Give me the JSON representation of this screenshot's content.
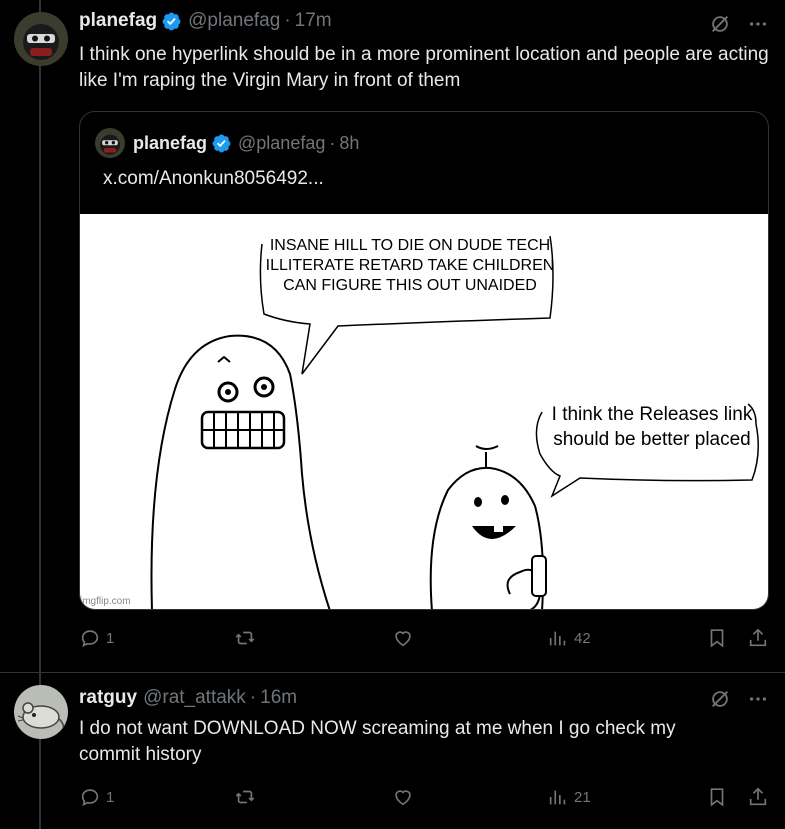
{
  "tweets": [
    {
      "name": "planefag",
      "handle": "@planefag",
      "separator": "·",
      "time": "17m",
      "text": "I think one hyperlink should be in a more prominent location and people are acting like I'm raping the Virgin Mary in front of them",
      "quote": {
        "name": "planefag",
        "handle": "@planefag",
        "separator": "·",
        "time": "8h",
        "link": "x.com/Anonkun8056492...",
        "image": {
          "bubble_left": "INSANE HILL TO DIE ON DUDE TECH ILLITERATE RETARD TAKE CHILDREN CAN FIGURE THIS OUT UNAIDED",
          "bubble_right": "I think the Releases link should be better placed",
          "watermark": "imgflip.com"
        }
      },
      "replies": "1",
      "reposts": "",
      "likes": "",
      "views": "42"
    },
    {
      "name": "ratguy",
      "handle": "@rat_attakk",
      "separator": "·",
      "time": "16m",
      "text": "I do not want DOWNLOAD NOW screaming at me when I go check my commit history",
      "replies": "1",
      "reposts": "",
      "likes": "",
      "views": "21"
    }
  ],
  "icons": {
    "grok": "grok-icon",
    "more": "more-icon",
    "reply": "reply-icon",
    "repost": "repost-icon",
    "like": "like-icon",
    "views": "views-icon",
    "bookmark": "bookmark-icon",
    "share": "share-icon",
    "verified": "verified-badge-icon"
  },
  "colors": {
    "background": "#000000",
    "text": "#e7e9ea",
    "muted": "#71767b",
    "border": "#2f3336",
    "verified": "#1d9bf0"
  }
}
